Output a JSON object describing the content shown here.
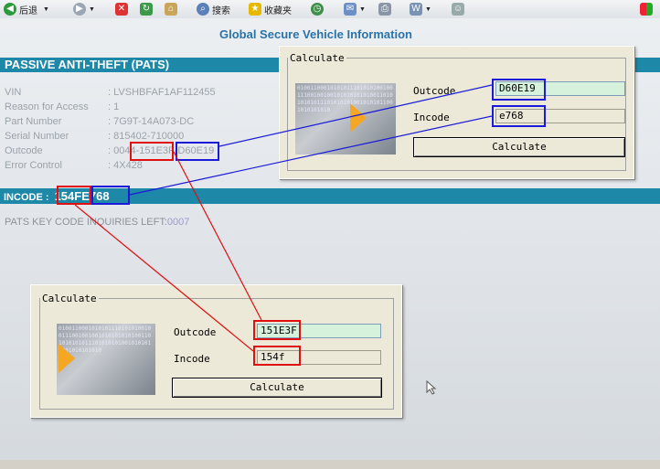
{
  "toolbar": {
    "back_label": "后退",
    "search_label": "搜索",
    "favorites_label": "收藏夹"
  },
  "page": {
    "title": "Global Secure Vehicle Information",
    "pats_header": "PASSIVE ANTI-THEFT (PATS)",
    "fields": [
      {
        "label": "VIN",
        "value": ": LVSHBFAF1AF112455"
      },
      {
        "label": "Reason for Access",
        "value": ": 1"
      },
      {
        "label": "Part Number",
        "value": ": 7G9T-14A073-DC"
      },
      {
        "label": "Serial Number",
        "value": ": 815402-710000"
      },
      {
        "label": "Outcode",
        "value": ": 0044-151E3F-D60E19"
      },
      {
        "label": "Error Control",
        "value": ": 4X428"
      }
    ],
    "incode_label": "INCODE :",
    "incode_part1": "154F",
    "incode_part2": "E768",
    "inquiries_label": "PATS KEY CODE INQUIRIES LEFT:",
    "inquiries_count": "0007"
  },
  "calc_windows": [
    {
      "title": "Calculate",
      "outcode_label": "Outcode",
      "outcode_value": "D60E19",
      "incode_label": "Incode",
      "incode_value": "e768",
      "button_label": "Calculate",
      "logo_bits": "0100110001010101110101010010011100100100101010101010011010101010111010101010010101011001010101010"
    },
    {
      "title": "Calculate",
      "outcode_label": "Outcode",
      "outcode_value": "151E3F",
      "incode_label": "Incode",
      "incode_value": "154f",
      "button_label": "Calculate",
      "logo_bits": "0100110001010101110101010010011100100100101010101010011010101010111010101010010101011001010101010"
    }
  ],
  "colors": {
    "band": "#1e88a8",
    "title": "#2a73a9",
    "highlight_red": "#e01010",
    "highlight_blue": "#1a1ad8",
    "outcode_field": "#d6f1dc"
  }
}
